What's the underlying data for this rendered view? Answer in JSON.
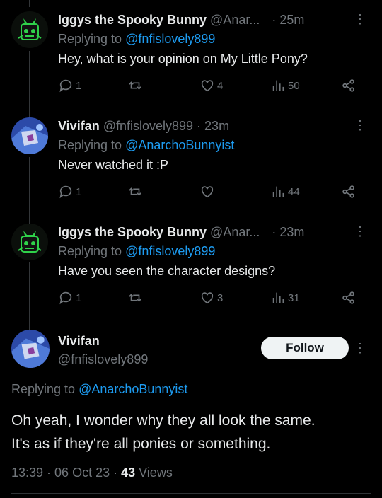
{
  "tweets": [
    {
      "name": "Iggys the Spooky Bunny",
      "handle": "@Anar...",
      "time": "· 25m",
      "reply_prefix": "Replying to ",
      "reply_to": "@fnfislovely899",
      "text": "Hey, what is your opinion on My Little Pony?",
      "replies": "1",
      "retweets": "",
      "likes": "4",
      "views": "50",
      "avatar": "spooky-bunny-avatar"
    },
    {
      "name": "Vivifan",
      "handle": "@fnfislovely899 · 23m",
      "time": "",
      "reply_prefix": "Replying to ",
      "reply_to": "@AnarchoBunnyist",
      "text": "Never watched it :P",
      "replies": "1",
      "retweets": "",
      "likes": "",
      "views": "44",
      "avatar": "vivifan-avatar"
    },
    {
      "name": "Iggys the Spooky Bunny",
      "handle": "@Anar...",
      "time": "· 23m",
      "reply_prefix": "Replying to ",
      "reply_to": "@fnfislovely899",
      "text": "Have you seen the character designs?",
      "replies": "1",
      "retweets": "",
      "likes": "3",
      "views": "31",
      "avatar": "spooky-bunny-avatar"
    }
  ],
  "main": {
    "name": "Vivifan",
    "handle": "@fnfislovely899",
    "follow_label": "Follow",
    "reply_prefix": "Replying to ",
    "reply_to": "@AnarchoBunnyist",
    "text_line1": "Oh yeah, I wonder why they all look the same.",
    "text_line2": "It's as if they're all ponies or something.",
    "time": "13:39 · 06 Oct 23 · ",
    "views_count": "43",
    "views_label": " Views"
  },
  "colors": {
    "accent": "#1d9bf0",
    "muted": "#71767b",
    "text": "#e7e9ea",
    "background": "#000000"
  }
}
